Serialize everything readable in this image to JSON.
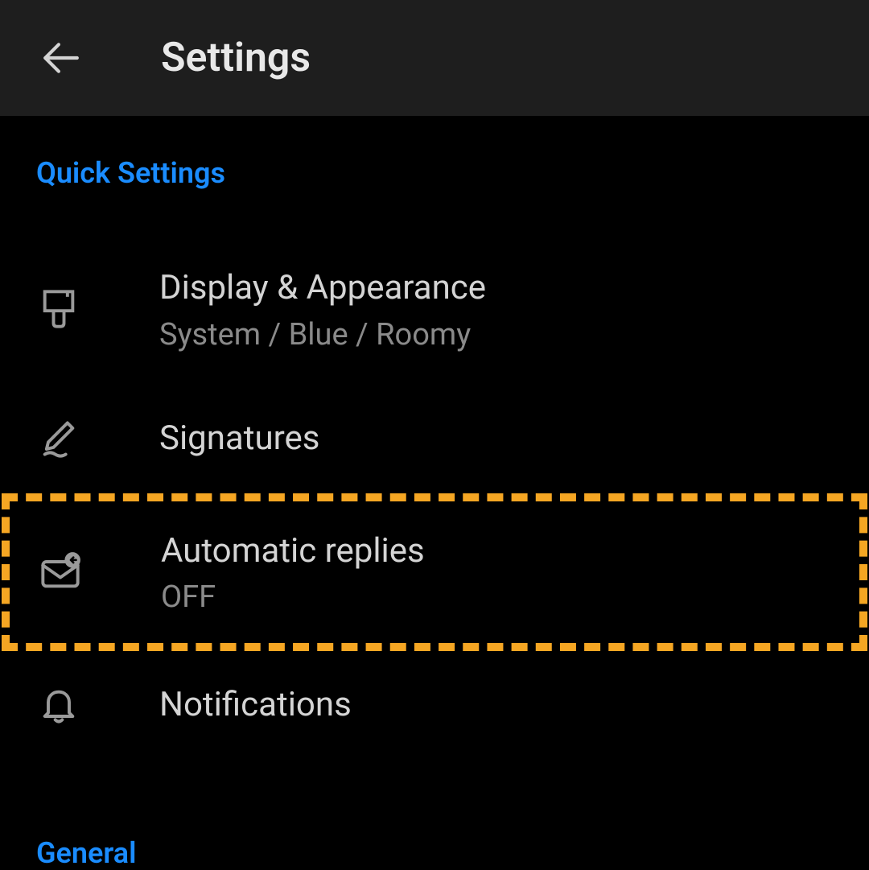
{
  "header": {
    "title": "Settings"
  },
  "sections": {
    "quick_settings": {
      "label": "Quick Settings",
      "items": {
        "display": {
          "title": "Display & Appearance",
          "subtitle": "System / Blue / Roomy"
        },
        "signatures": {
          "title": "Signatures"
        },
        "automatic_replies": {
          "title": "Automatic replies",
          "subtitle": "OFF"
        },
        "notifications": {
          "title": "Notifications"
        }
      }
    },
    "general": {
      "label": "General"
    }
  }
}
